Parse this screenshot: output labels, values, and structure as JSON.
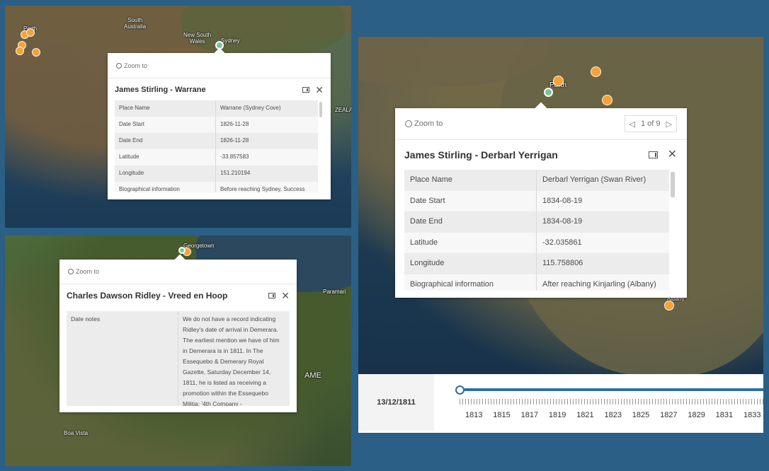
{
  "panel1": {
    "map_labels": [
      "Perth",
      "South\nAustralia",
      "New South\nWales",
      "Sydney",
      "ZEALAN"
    ],
    "popup": {
      "zoom_label": "Zoom to",
      "title": "James Stirling - Warrane",
      "rows": [
        {
          "key": "Place Name",
          "value": "Warrane (Sydney Cove)"
        },
        {
          "key": "Date Start",
          "value": "1826-11-28"
        },
        {
          "key": "Date End",
          "value": "1826-11-28"
        },
        {
          "key": "Latitude",
          "value": "-33.857583"
        },
        {
          "key": "Longitude",
          "value": "151.210194"
        },
        {
          "key": "Biographical information",
          "value": "Before reaching Sydney, Success"
        }
      ],
      "icons": {
        "zoom": "magnifier-icon",
        "dock": "dock-icon",
        "close": "close-icon"
      }
    }
  },
  "panel2": {
    "map_labels": [
      "Georgetown",
      "Paramari",
      "AME",
      "Boa Vista"
    ],
    "popup": {
      "zoom_label": "Zoom to",
      "title": "Charles Dawson Ridley - Vreed en Hoop",
      "rows": [
        {
          "key": "Date notes",
          "value": "We do not have a record indicating Ridley's date of arrival in Demerara. The earliest mention we have of him in Demerara is in 1811. In The Essequebo & Demerary Royal Gazette, Saturday December 14, 1811, he is listed as receiving a promotion within the Essequebo Militia: '4th Company -"
        }
      ]
    }
  },
  "panel3": {
    "map_labels": [
      "Perth",
      "Albany"
    ],
    "popup": {
      "zoom_label": "Zoom to",
      "pager": "1 of 9",
      "title": "James Stirling - Derbarl Yerrigan",
      "rows": [
        {
          "key": "Place Name",
          "value": "Derbarl Yerrigan (Swan River)"
        },
        {
          "key": "Date Start",
          "value": "1834-08-19"
        },
        {
          "key": "Date End",
          "value": "1834-08-19"
        },
        {
          "key": "Latitude",
          "value": "-32.035861"
        },
        {
          "key": "Longitude",
          "value": "115.758806"
        },
        {
          "key": "Biographical information",
          "value": "After reaching Kinjarling (Albany)"
        }
      ]
    },
    "timeline": {
      "current_date": "13/12/1811",
      "years": [
        "1813",
        "1815",
        "1817",
        "1819",
        "1821",
        "1823",
        "1825",
        "1827",
        "1829",
        "1831",
        "1833"
      ]
    }
  },
  "colors": {
    "background": "#2b5f85",
    "marker": "#f2a33a",
    "selected_marker": "#7bc39a",
    "slider": "#2d6fa3"
  }
}
